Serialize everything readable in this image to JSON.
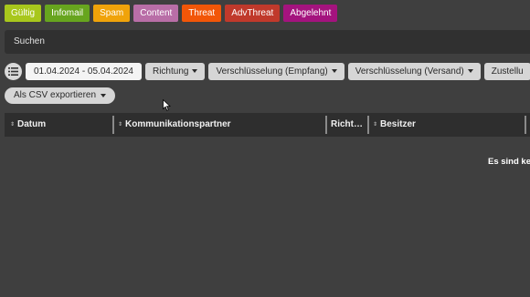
{
  "tags": [
    {
      "label": "Gültig",
      "color": "#a8c71c"
    },
    {
      "label": "Infomail",
      "color": "#67a51e"
    },
    {
      "label": "Spam",
      "color": "#f0a30a"
    },
    {
      "label": "Content",
      "color": "#b96ea7"
    },
    {
      "label": "Threat",
      "color": "#f25608"
    },
    {
      "label": "AdvThreat",
      "color": "#c0392b"
    },
    {
      "label": "Abgelehnt",
      "color": "#a4137e"
    }
  ],
  "search": {
    "label": "Suchen"
  },
  "filters": {
    "date_range": "01.04.2024 - 05.04.2024",
    "direction": "Richtung",
    "enc_receive": "Verschlüsselung (Empfang)",
    "enc_send": "Verschlüsselung (Versand)",
    "delivery": "Zustellu"
  },
  "export": {
    "label": "Als CSV exportieren"
  },
  "table": {
    "columns": [
      "Datum",
      "Kommunikationspartner",
      "Richt…",
      "Besitzer"
    ],
    "empty_text": "Es sind kei"
  }
}
